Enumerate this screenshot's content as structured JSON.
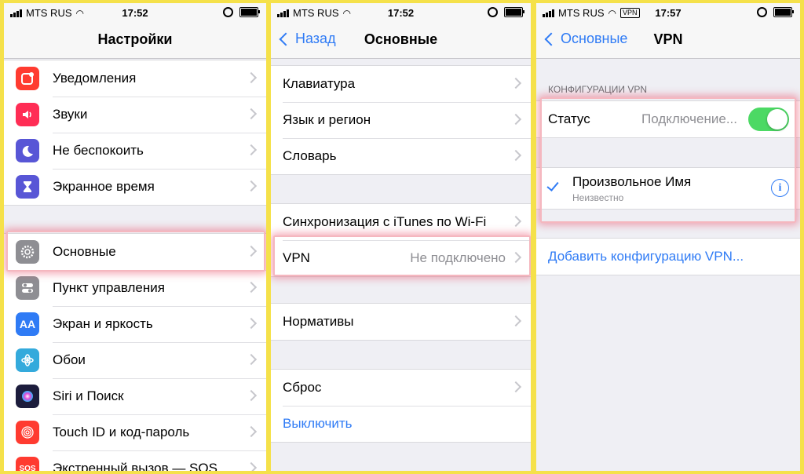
{
  "screens": [
    {
      "status": {
        "carrier": "MTS RUS",
        "time": "17:52"
      },
      "nav": {
        "title": "Настройки"
      },
      "groups": [
        [
          {
            "label": "Уведомления",
            "icon": "notifications-icon",
            "color": "#ff3b30"
          },
          {
            "label": "Звуки",
            "icon": "sounds-icon",
            "color": "#ff2d55"
          },
          {
            "label": "Не беспокоить",
            "icon": "moon-icon",
            "color": "#5856d6"
          },
          {
            "label": "Экранное время",
            "icon": "hourglass-icon",
            "color": "#5856d6"
          }
        ],
        [
          {
            "label": "Основные",
            "icon": "gear-icon",
            "color": "#8e8e93"
          },
          {
            "label": "Пункт управления",
            "icon": "control-center-icon",
            "color": "#8e8e93"
          },
          {
            "label": "Экран и яркость",
            "icon": "display-icon",
            "glyph": "AA",
            "color": "#2f7bf5"
          },
          {
            "label": "Обои",
            "icon": "wallpaper-icon",
            "color": "#34aadc"
          },
          {
            "label": "Siri и Поиск",
            "icon": "siri-icon",
            "color": "#1c1c3c"
          },
          {
            "label": "Touch ID и код-пароль",
            "icon": "fingerprint-icon",
            "color": "#ff3b30"
          },
          {
            "label": "Экстренный вызов — SOS",
            "icon": "sos-icon",
            "glyph": "SOS",
            "color": "#ff3b30"
          }
        ]
      ]
    },
    {
      "status": {
        "carrier": "MTS RUS",
        "time": "17:52"
      },
      "nav": {
        "title": "Основные",
        "back": "Назад"
      },
      "groups": [
        [
          {
            "label": "Клавиатура"
          },
          {
            "label": "Язык и регион"
          },
          {
            "label": "Словарь"
          }
        ],
        [
          {
            "label": "Синхронизация с iTunes по Wi-Fi"
          },
          {
            "label": "VPN",
            "value": "Не подключено"
          }
        ],
        [
          {
            "label": "Нормативы"
          }
        ],
        [
          {
            "label": "Сброс"
          },
          {
            "label": "Выключить",
            "accent": true
          }
        ]
      ]
    },
    {
      "status": {
        "carrier": "MTS RUS",
        "badge": "VPN",
        "time": "17:57"
      },
      "nav": {
        "title": "VPN",
        "back": "Основные"
      },
      "section_header": "КОНФИГУРАЦИИ VPN",
      "status_row": {
        "label": "Статус",
        "value": "Подключение...",
        "toggle_on": true
      },
      "config": {
        "name": "Произвольное Имя",
        "subtitle": "Неизвестно",
        "selected": true
      },
      "add_link": "Добавить конфигурацию VPN..."
    }
  ],
  "colors": {
    "accent": "#2f7bf5",
    "frame": "#f5e14a",
    "toggle": "#4cd964"
  }
}
